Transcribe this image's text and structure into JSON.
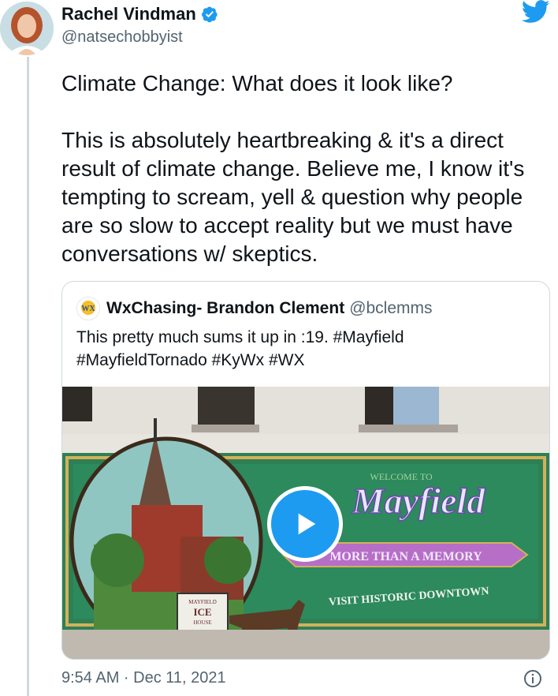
{
  "author": {
    "name": "Rachel Vindman",
    "handle": "@natsechobbyist"
  },
  "tweet": {
    "text": "Climate Change: What does it look like?\n\nThis is absolutely heartbreaking & it's a direct result of climate change. Believe me, I know it's tempting to scream, yell & question why people are so slow to accept reality but we must have conversations w/ skeptics."
  },
  "quoted": {
    "logo_text": "WX",
    "name": "WxChasing- Brandon Clement",
    "handle": "@bclemms",
    "text": "This pretty much sums it up in :19. #Mayfield\n#MayfieldTornado #KyWx #WX",
    "media": {
      "sign_welcome": "WELCOME TO",
      "sign_title": "Mayfield",
      "sign_banner": "MORE THAN A MEMORY",
      "sign_sub": "VISIT HISTORIC DOWNTOWN",
      "cart_label_top": "MAYFIELD",
      "cart_label_main": "ICE",
      "cart_label_bottom": "HOUSE"
    }
  },
  "timestamp": "9:54 AM · Dec 11, 2021",
  "icons": [
    "verified-badge-icon",
    "twitter-bird-icon",
    "play-icon",
    "info-icon"
  ],
  "colors": {
    "accent": "#1d9bf0",
    "text": "#0f1419",
    "muted": "#536471",
    "border": "#cfd9de"
  }
}
